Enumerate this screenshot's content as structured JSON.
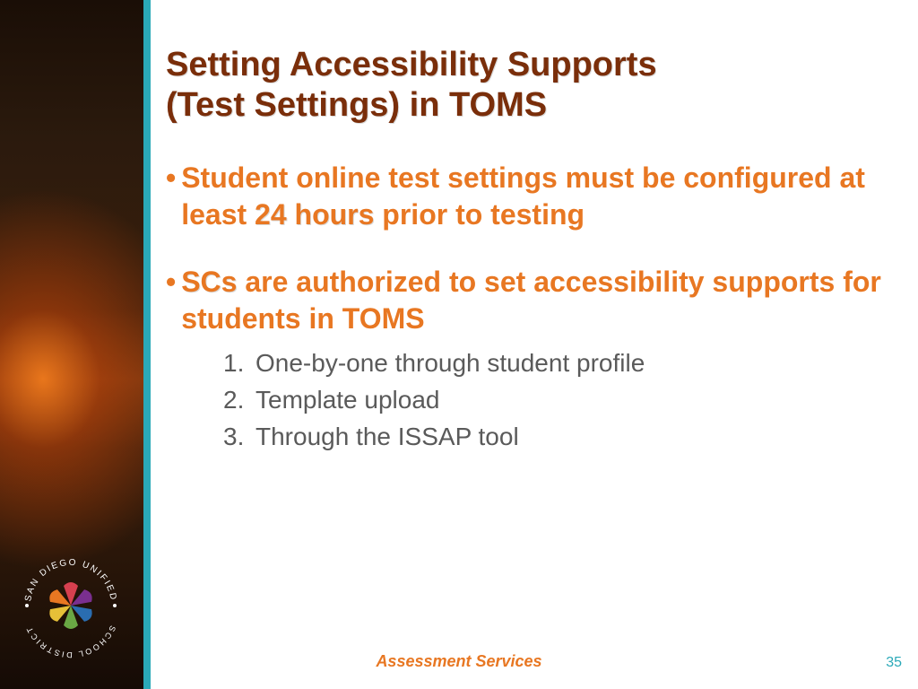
{
  "title_line1": "Setting Accessibility Supports",
  "title_line2": "(Test Settings) in TOMS",
  "bullet1_pre": "Student online test settings must be configured at least ",
  "bullet1_strong": "24 hours",
  "bullet1_post": " prior to testing",
  "bullet2_scs": "SCs",
  "bullet2_rest": " are authorized to set accessibility supports for students in TOMS",
  "sub": {
    "n1": "1.",
    "t1": "One-by-one through student profile",
    "n2": "2.",
    "t2": "Template upload",
    "n3": "3.",
    "t3": "Through the ISSAP tool"
  },
  "footer": "Assessment Services",
  "page": "35",
  "logo": {
    "top_arc": "SAN DIEGO UNIFIED",
    "bottom_arc": "SCHOOL DISTRICT"
  },
  "colors": {
    "accent": "#e87722",
    "title": "#7a2e0a",
    "teal": "#2aa9b8"
  }
}
